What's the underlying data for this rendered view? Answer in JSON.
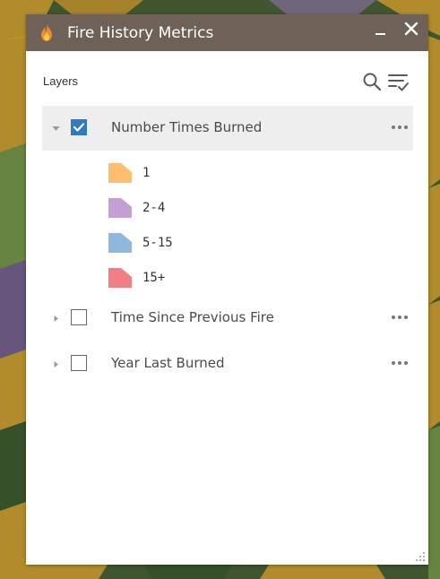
{
  "panel": {
    "title": "Fire History Metrics",
    "title_icon": "flame-icon",
    "minimize_icon": "minimize-icon",
    "close_icon": "close-icon",
    "colors": {
      "titlebar": "#6e6258",
      "accent": "#2d7bc4",
      "active_row": "#eeeeee"
    }
  },
  "layers_header": {
    "label": "Layers",
    "search_icon": "search-icon",
    "filter_icon": "filter-list-icon"
  },
  "layers": [
    {
      "name": "Number Times Burned",
      "checked": true,
      "expanded": true,
      "legend": [
        {
          "label": "1",
          "color": "#fdbf6f"
        },
        {
          "label": "2-4",
          "color": "#c49fd4"
        },
        {
          "label": "5-15",
          "color": "#8fb8dc"
        },
        {
          "label": "15+",
          "color": "#ef7f84"
        }
      ]
    },
    {
      "name": "Time Since Previous Fire",
      "checked": false,
      "expanded": false
    },
    {
      "name": "Year Last Burned",
      "checked": false,
      "expanded": false
    }
  ]
}
